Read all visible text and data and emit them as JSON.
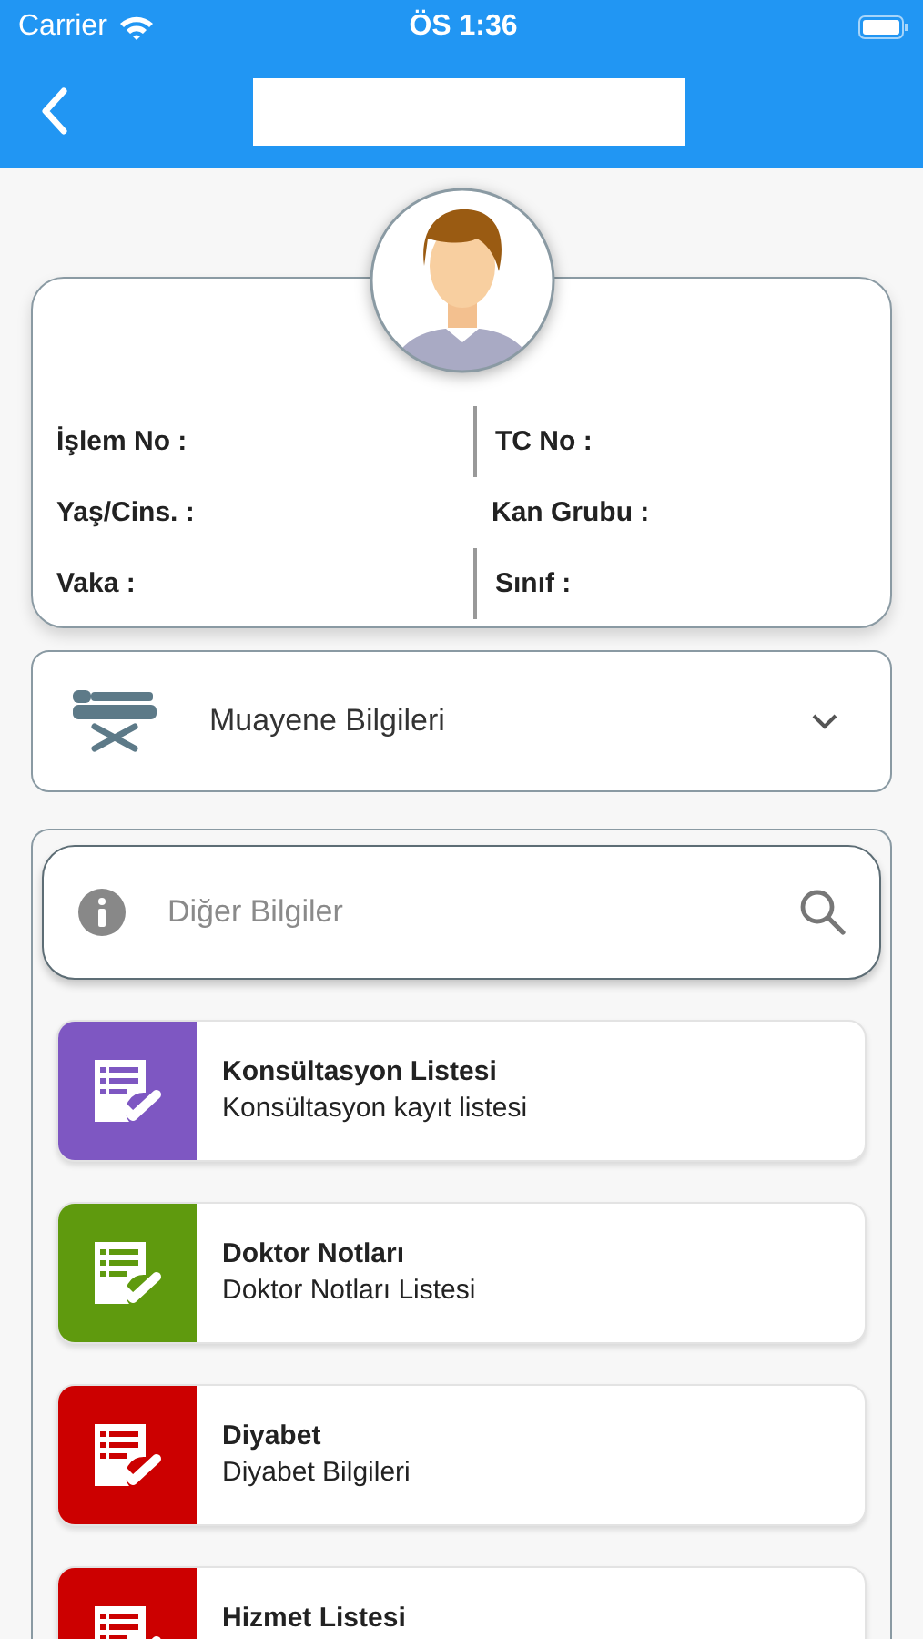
{
  "status_bar": {
    "carrier": "Carrier",
    "time": "ÖS 1:36"
  },
  "patient": {
    "fields": [
      {
        "label": "İşlem No :"
      },
      {
        "label": "TC No :"
      },
      {
        "label": "Yaş/Cins. :"
      },
      {
        "label": "Kan Grubu :"
      },
      {
        "label": "Vaka :"
      },
      {
        "label": "Sınıf :"
      }
    ]
  },
  "exam_dropdown": {
    "label": "Muayene Bilgileri",
    "expanded": false
  },
  "search": {
    "placeholder": "Diğer Bilgiler"
  },
  "items": [
    {
      "title": "Konsültasyon Listesi",
      "subtitle": "Konsültasyon kayıt listesi",
      "color": "#7e57c2"
    },
    {
      "title": "Doktor Notları",
      "subtitle": "Doktor Notları Listesi",
      "color": "#5f9a0e"
    },
    {
      "title": "Diyabet",
      "subtitle": "Diyabet Bilgileri",
      "color": "#cc0000"
    },
    {
      "title": "Hizmet Listesi",
      "color": "#cc0000"
    }
  ]
}
